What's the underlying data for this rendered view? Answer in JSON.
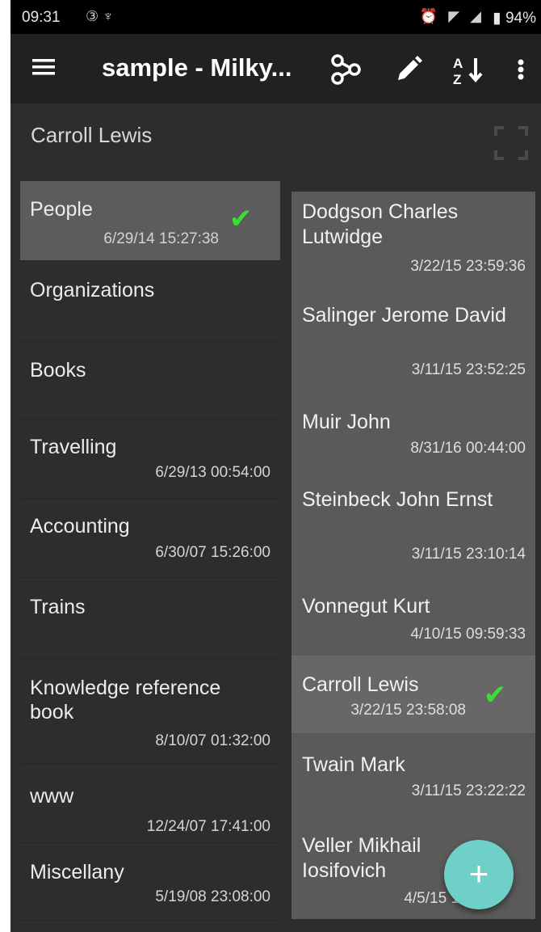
{
  "status_bar": {
    "time": "09:31",
    "left_icons": "③ ♆",
    "right_icons": "⏰ ◤ ◢",
    "battery": "▮ 94%"
  },
  "toolbar": {
    "title": "sample - Milky...",
    "icons": [
      "menu-icon",
      "graph-icon",
      "edit-icon",
      "sort-az-icon",
      "more-vert-icon"
    ]
  },
  "header": {
    "title": "Carroll Lewis"
  },
  "left_list": [
    {
      "name": "People",
      "date": "6/29/14 15:27:38",
      "selected": true
    },
    {
      "name": "Organizations",
      "date": ""
    },
    {
      "name": "Books",
      "date": ""
    },
    {
      "name": "Travelling",
      "date": "6/29/13 00:54:00"
    },
    {
      "name": "Accounting",
      "date": "6/30/07 15:26:00"
    },
    {
      "name": "Trains",
      "date": ""
    },
    {
      "name": "Knowledge reference book",
      "date": "8/10/07 01:32:00"
    },
    {
      "name": "www",
      "date": "12/24/07 17:41:00"
    },
    {
      "name": "Miscellany",
      "date": "5/19/08 23:08:00"
    }
  ],
  "right_list": [
    {
      "name": "Dodgson Charles Lutwidge",
      "date": "3/22/15 23:59:36"
    },
    {
      "name": "Salinger Jerome David",
      "date": "3/11/15 23:52:25"
    },
    {
      "name": "Muir John",
      "date": "8/31/16 00:44:00"
    },
    {
      "name": "Steinbeck John Ernst",
      "date": "3/11/15 23:10:14"
    },
    {
      "name": "Vonnegut Kurt",
      "date": "4/10/15 09:59:33"
    },
    {
      "name": "Carroll Lewis",
      "date": "3/22/15 23:58:08",
      "selected": true
    },
    {
      "name": "Twain Mark",
      "date": "3/11/15 23:22:22"
    },
    {
      "name": "Veller Mikhail Iosifovich",
      "date": "4/5/15 1"
    }
  ],
  "fab": {
    "label": "+"
  },
  "colors": {
    "check": "#3ddc36",
    "fab": "#6fd0c8",
    "background": "#2d2d2d"
  }
}
